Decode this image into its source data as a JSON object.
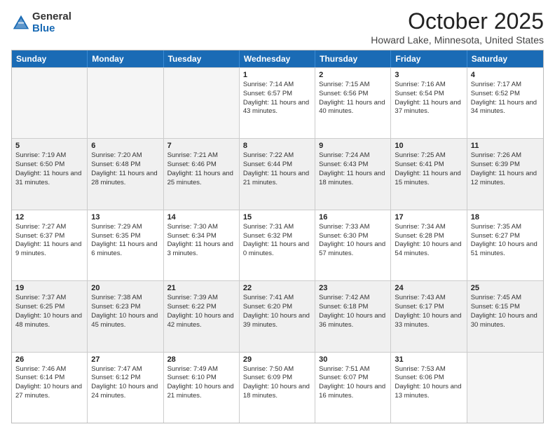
{
  "logo": {
    "general": "General",
    "blue": "Blue"
  },
  "header": {
    "month": "October 2025",
    "location": "Howard Lake, Minnesota, United States"
  },
  "days_of_week": [
    "Sunday",
    "Monday",
    "Tuesday",
    "Wednesday",
    "Thursday",
    "Friday",
    "Saturday"
  ],
  "weeks": [
    [
      {
        "day": "",
        "empty": true
      },
      {
        "day": "",
        "empty": true
      },
      {
        "day": "",
        "empty": true
      },
      {
        "day": "1",
        "sunrise": "Sunrise: 7:14 AM",
        "sunset": "Sunset: 6:57 PM",
        "daylight": "Daylight: 11 hours and 43 minutes."
      },
      {
        "day": "2",
        "sunrise": "Sunrise: 7:15 AM",
        "sunset": "Sunset: 6:56 PM",
        "daylight": "Daylight: 11 hours and 40 minutes."
      },
      {
        "day": "3",
        "sunrise": "Sunrise: 7:16 AM",
        "sunset": "Sunset: 6:54 PM",
        "daylight": "Daylight: 11 hours and 37 minutes."
      },
      {
        "day": "4",
        "sunrise": "Sunrise: 7:17 AM",
        "sunset": "Sunset: 6:52 PM",
        "daylight": "Daylight: 11 hours and 34 minutes."
      }
    ],
    [
      {
        "day": "5",
        "sunrise": "Sunrise: 7:19 AM",
        "sunset": "Sunset: 6:50 PM",
        "daylight": "Daylight: 11 hours and 31 minutes."
      },
      {
        "day": "6",
        "sunrise": "Sunrise: 7:20 AM",
        "sunset": "Sunset: 6:48 PM",
        "daylight": "Daylight: 11 hours and 28 minutes."
      },
      {
        "day": "7",
        "sunrise": "Sunrise: 7:21 AM",
        "sunset": "Sunset: 6:46 PM",
        "daylight": "Daylight: 11 hours and 25 minutes."
      },
      {
        "day": "8",
        "sunrise": "Sunrise: 7:22 AM",
        "sunset": "Sunset: 6:44 PM",
        "daylight": "Daylight: 11 hours and 21 minutes."
      },
      {
        "day": "9",
        "sunrise": "Sunrise: 7:24 AM",
        "sunset": "Sunset: 6:43 PM",
        "daylight": "Daylight: 11 hours and 18 minutes."
      },
      {
        "day": "10",
        "sunrise": "Sunrise: 7:25 AM",
        "sunset": "Sunset: 6:41 PM",
        "daylight": "Daylight: 11 hours and 15 minutes."
      },
      {
        "day": "11",
        "sunrise": "Sunrise: 7:26 AM",
        "sunset": "Sunset: 6:39 PM",
        "daylight": "Daylight: 11 hours and 12 minutes."
      }
    ],
    [
      {
        "day": "12",
        "sunrise": "Sunrise: 7:27 AM",
        "sunset": "Sunset: 6:37 PM",
        "daylight": "Daylight: 11 hours and 9 minutes."
      },
      {
        "day": "13",
        "sunrise": "Sunrise: 7:29 AM",
        "sunset": "Sunset: 6:35 PM",
        "daylight": "Daylight: 11 hours and 6 minutes."
      },
      {
        "day": "14",
        "sunrise": "Sunrise: 7:30 AM",
        "sunset": "Sunset: 6:34 PM",
        "daylight": "Daylight: 11 hours and 3 minutes."
      },
      {
        "day": "15",
        "sunrise": "Sunrise: 7:31 AM",
        "sunset": "Sunset: 6:32 PM",
        "daylight": "Daylight: 11 hours and 0 minutes."
      },
      {
        "day": "16",
        "sunrise": "Sunrise: 7:33 AM",
        "sunset": "Sunset: 6:30 PM",
        "daylight": "Daylight: 10 hours and 57 minutes."
      },
      {
        "day": "17",
        "sunrise": "Sunrise: 7:34 AM",
        "sunset": "Sunset: 6:28 PM",
        "daylight": "Daylight: 10 hours and 54 minutes."
      },
      {
        "day": "18",
        "sunrise": "Sunrise: 7:35 AM",
        "sunset": "Sunset: 6:27 PM",
        "daylight": "Daylight: 10 hours and 51 minutes."
      }
    ],
    [
      {
        "day": "19",
        "sunrise": "Sunrise: 7:37 AM",
        "sunset": "Sunset: 6:25 PM",
        "daylight": "Daylight: 10 hours and 48 minutes."
      },
      {
        "day": "20",
        "sunrise": "Sunrise: 7:38 AM",
        "sunset": "Sunset: 6:23 PM",
        "daylight": "Daylight: 10 hours and 45 minutes."
      },
      {
        "day": "21",
        "sunrise": "Sunrise: 7:39 AM",
        "sunset": "Sunset: 6:22 PM",
        "daylight": "Daylight: 10 hours and 42 minutes."
      },
      {
        "day": "22",
        "sunrise": "Sunrise: 7:41 AM",
        "sunset": "Sunset: 6:20 PM",
        "daylight": "Daylight: 10 hours and 39 minutes."
      },
      {
        "day": "23",
        "sunrise": "Sunrise: 7:42 AM",
        "sunset": "Sunset: 6:18 PM",
        "daylight": "Daylight: 10 hours and 36 minutes."
      },
      {
        "day": "24",
        "sunrise": "Sunrise: 7:43 AM",
        "sunset": "Sunset: 6:17 PM",
        "daylight": "Daylight: 10 hours and 33 minutes."
      },
      {
        "day": "25",
        "sunrise": "Sunrise: 7:45 AM",
        "sunset": "Sunset: 6:15 PM",
        "daylight": "Daylight: 10 hours and 30 minutes."
      }
    ],
    [
      {
        "day": "26",
        "sunrise": "Sunrise: 7:46 AM",
        "sunset": "Sunset: 6:14 PM",
        "daylight": "Daylight: 10 hours and 27 minutes."
      },
      {
        "day": "27",
        "sunrise": "Sunrise: 7:47 AM",
        "sunset": "Sunset: 6:12 PM",
        "daylight": "Daylight: 10 hours and 24 minutes."
      },
      {
        "day": "28",
        "sunrise": "Sunrise: 7:49 AM",
        "sunset": "Sunset: 6:10 PM",
        "daylight": "Daylight: 10 hours and 21 minutes."
      },
      {
        "day": "29",
        "sunrise": "Sunrise: 7:50 AM",
        "sunset": "Sunset: 6:09 PM",
        "daylight": "Daylight: 10 hours and 18 minutes."
      },
      {
        "day": "30",
        "sunrise": "Sunrise: 7:51 AM",
        "sunset": "Sunset: 6:07 PM",
        "daylight": "Daylight: 10 hours and 16 minutes."
      },
      {
        "day": "31",
        "sunrise": "Sunrise: 7:53 AM",
        "sunset": "Sunset: 6:06 PM",
        "daylight": "Daylight: 10 hours and 13 minutes."
      },
      {
        "day": "",
        "empty": true
      }
    ]
  ]
}
